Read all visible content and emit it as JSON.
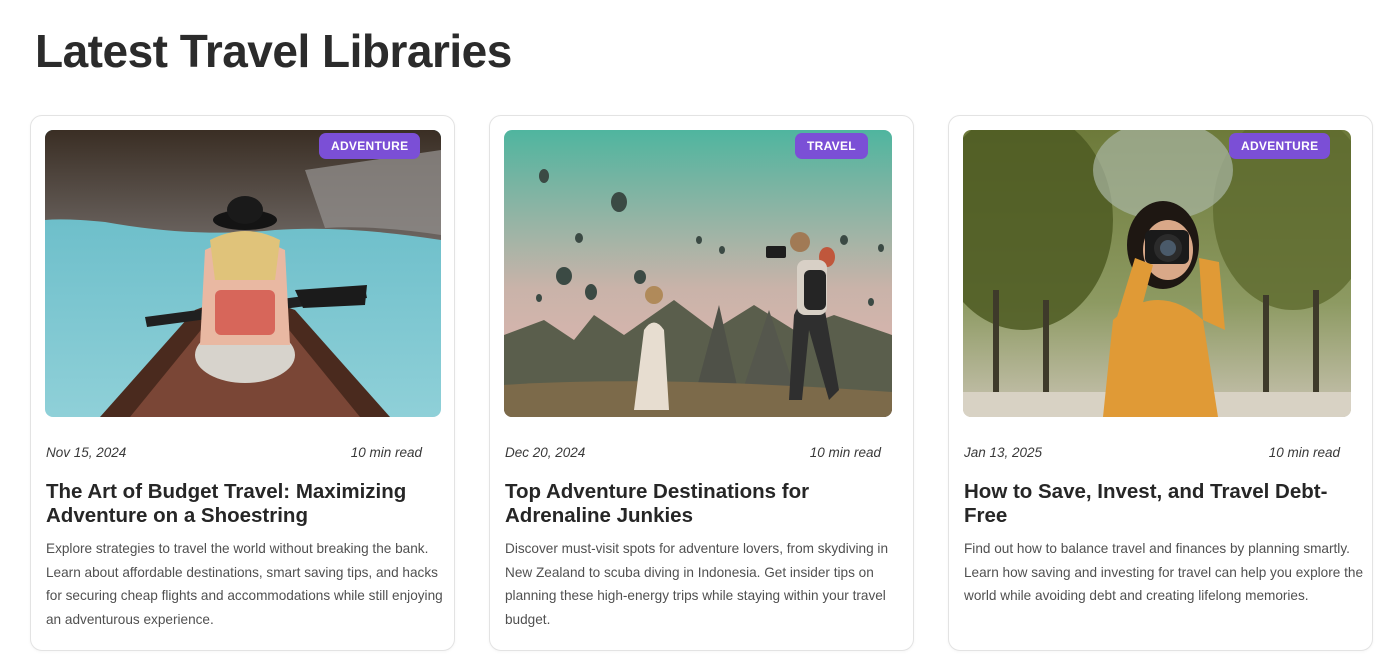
{
  "page": {
    "title": "Latest Travel Libraries"
  },
  "cards": [
    {
      "badge": "ADVENTURE",
      "date": "Nov 15, 2024",
      "read_time": "10 min read",
      "title": "The Art of Budget Travel: Maximizing Adventure on a Shoestring",
      "description": "Explore strategies to travel the world without breaking the bank. Learn about affordable destinations, smart saving tips, and hacks for securing cheap flights and accommodations while still enjoying an adventurous experience."
    },
    {
      "badge": "TRAVEL",
      "date": "Dec 20, 2024",
      "read_time": "10 min read",
      "title": "Top Adventure Destinations for Adrenaline Junkies",
      "description": "Discover must-visit spots for adventure lovers, from skydiving in New Zealand to scuba diving in Indonesia. Get insider tips on planning these high-energy trips while staying within your travel budget."
    },
    {
      "badge": "ADVENTURE",
      "date": "Jan 13, 2025",
      "read_time": "10 min read",
      "title": "How to Save, Invest, and Travel Debt-Free",
      "description": "Find out how to balance travel and finances by planning smartly. Learn how saving and investing for travel can help you explore the world while avoiding debt and creating lifelong memories."
    }
  ],
  "colors": {
    "badge_bg": "#7b4fd6",
    "text": "#2a2a2a"
  }
}
